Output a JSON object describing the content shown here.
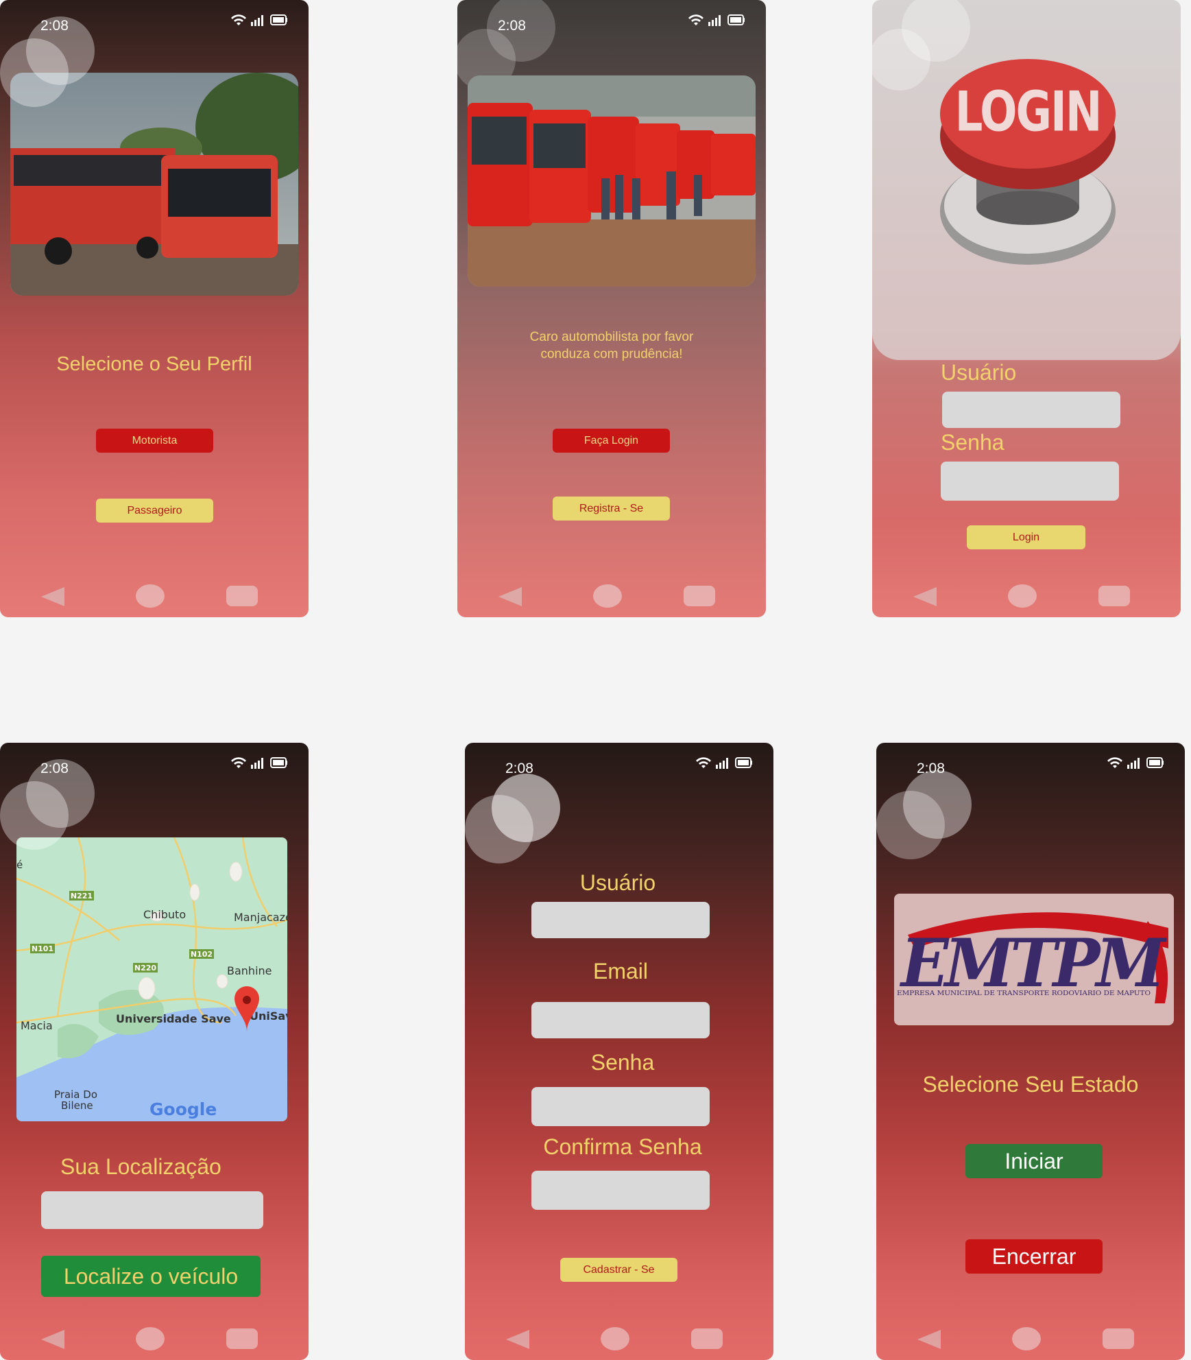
{
  "status": {
    "time": "2:08"
  },
  "screens": {
    "profile": {
      "title": "Selecione o Seu Perfil",
      "btn_driver": "Motorista",
      "btn_passenger": "Passageiro"
    },
    "welcome": {
      "message": "Caro automobilista por favor conduza com prudência!",
      "btn_login": "Faça Login",
      "btn_register": "Registra - Se"
    },
    "login": {
      "login_badge": "LOGIN",
      "label_user": "Usuário",
      "label_password": "Senha",
      "btn_login": "Login"
    },
    "map": {
      "places": {
        "chibuto": "Chibuto",
        "manjacaze": "Manjacaze",
        "banhine": "Banhine",
        "macia": "Macia",
        "universidade": "Universidade Save",
        "unisave": "UniSav",
        "praia1": "Praia Do",
        "praia2": "Bilene",
        "n221": "N221",
        "n101": "N101",
        "n220": "N220",
        "n102": "N102",
        "google": "Google",
        "edge": "é"
      },
      "label_location": "Sua Localização",
      "btn_locate": "Localize o veículo"
    },
    "register": {
      "label_user": "Usuário",
      "label_email": "Email",
      "label_password": "Senha",
      "label_confirm": "Confirma Senha",
      "btn_register": "Cadastrar - Se"
    },
    "status_screen": {
      "logo_text": "EMTPM",
      "logo_subtitle": "EMPRESA MUNICIPAL DE TRANSPORTE RODOVIARIO DE MAPUTO",
      "title": "Selecione Seu Estado",
      "btn_start": "Iniciar",
      "btn_end": "Encerrar"
    }
  }
}
